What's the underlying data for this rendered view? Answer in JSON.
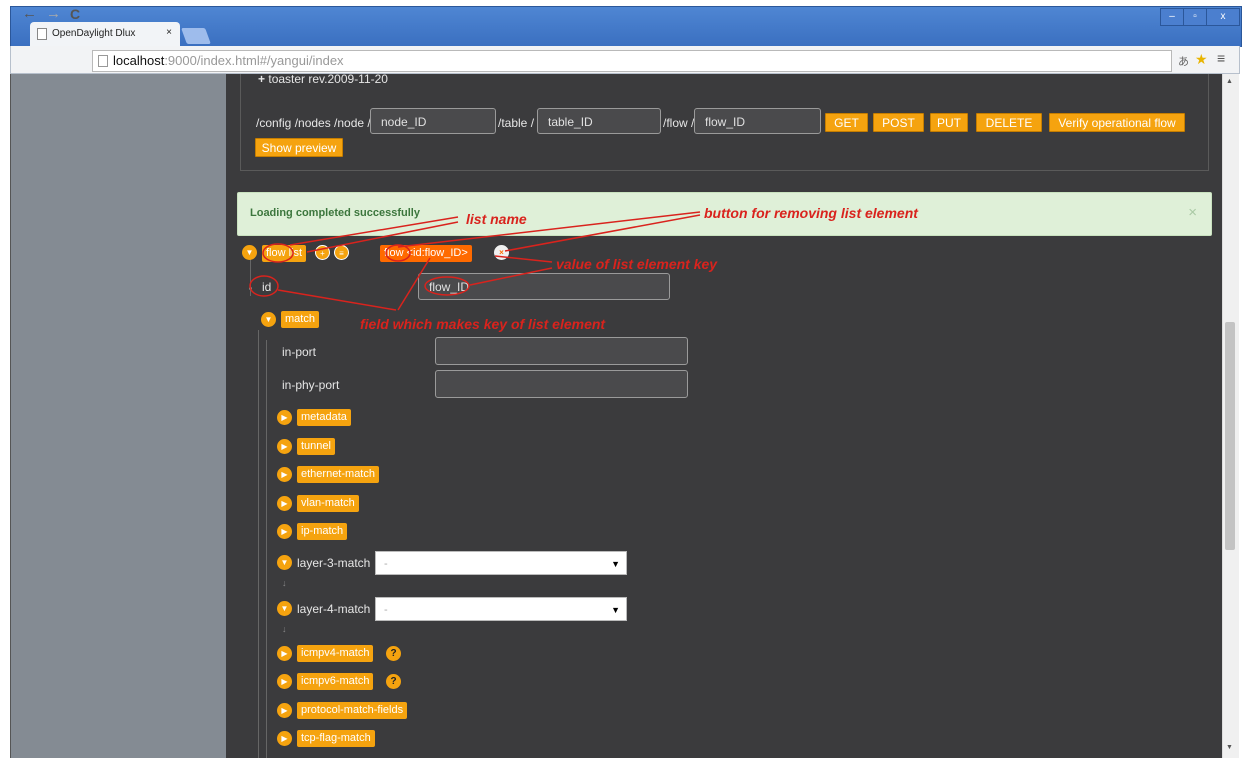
{
  "browser": {
    "tab_title": "OpenDaylight Dlux",
    "tab_close": "×",
    "url_host": "localhost",
    "url_rest": ":9000/index.html#/yangui/index",
    "win_min": "–",
    "win_max": "▫",
    "win_close": "x"
  },
  "api_panel": {
    "header": "toaster rev.2009-11-20",
    "path_prefix": "/config /nodes /node /",
    "node_id": "node_ID",
    "table_label": "/table /",
    "table_id": "table_ID",
    "flow_label": "/flow /",
    "flow_id": "flow_ID",
    "buttons": [
      "GET",
      "POST",
      "PUT",
      "DELETE",
      "Verify operational flow"
    ],
    "show_preview": "Show preview"
  },
  "alert": {
    "message": "Loading completed successfully",
    "close": "×"
  },
  "tree": {
    "list_name": "flow list",
    "list_element": "flow <id:flow_ID>",
    "id_label": "id",
    "id_value": "flow_ID",
    "match_label": "match",
    "in_port": "in-port",
    "in_phy_port": "in-phy-port",
    "nodes": [
      "metadata",
      "tunnel",
      "ethernet-match",
      "vlan-match",
      "ip-match"
    ],
    "layer3": "layer-3-match",
    "layer4": "layer-4-match",
    "select_placeholder": "-",
    "more_nodes": [
      "icmpv4-match",
      "icmpv6-match",
      "protocol-match-fields",
      "tcp-flag-match"
    ],
    "help": "?"
  },
  "annotations": {
    "list_name": "list name",
    "remove_button": "button for removing list element",
    "key_value": "value of list element key",
    "key_field": "field which makes key of list element"
  },
  "colors": {
    "accent": "#f5a30f",
    "annotation": "#d9231d",
    "alert_bg": "#dff0d8",
    "content_bg": "#3b3b3d"
  }
}
